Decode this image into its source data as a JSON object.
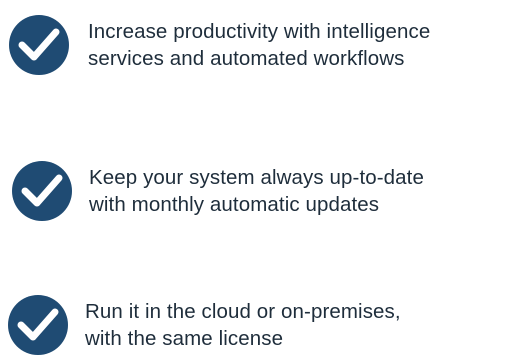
{
  "colors": {
    "check_circle": "#1f4b73",
    "check_mark": "#ffffff",
    "text": "#1e2d3b"
  },
  "features": [
    {
      "icon": "check-circle-icon",
      "lines": [
        "Increase productivity with intelligence",
        "services and automated workflows"
      ]
    },
    {
      "icon": "check-circle-icon",
      "lines": [
        "Keep your system always up-to-date",
        "with monthly automatic updates"
      ]
    },
    {
      "icon": "check-circle-icon",
      "lines": [
        "Run it in the cloud or on-premises,",
        "with the same license"
      ]
    }
  ]
}
